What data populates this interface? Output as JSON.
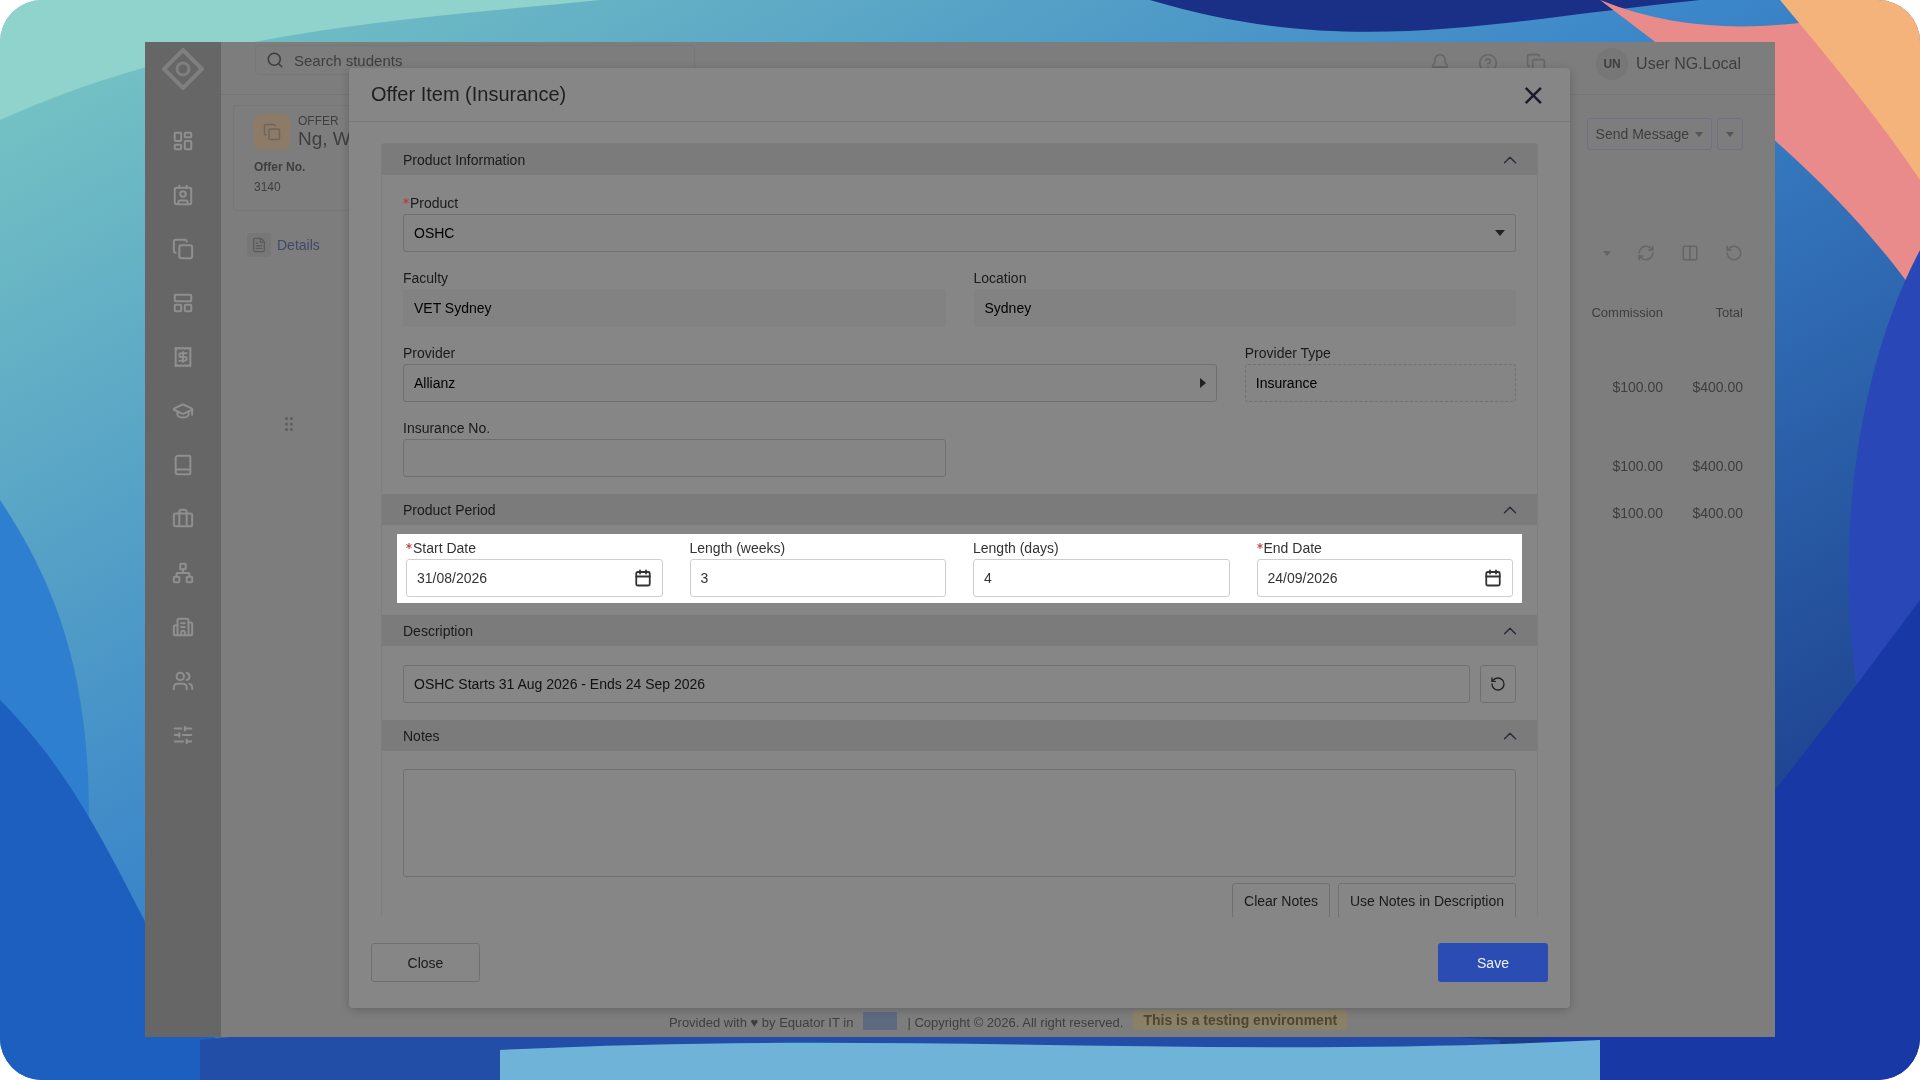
{
  "app": {
    "search": {
      "placeholder": "Search students"
    },
    "user": {
      "initials": "UN",
      "name": "User NG.Local"
    },
    "offer": {
      "label": "OFFER",
      "name": "Ng, W",
      "number_label": "Offer No.",
      "number": "3140",
      "tab": "Details"
    },
    "actions": {
      "send_message": "Send Message"
    },
    "table": {
      "columns": [
        "Commission",
        "Total"
      ],
      "rows": [
        [
          "$100.00",
          "$400.00"
        ],
        [
          "$100.00",
          "$400.00"
        ],
        [
          "$100.00",
          "$400.00"
        ]
      ]
    },
    "footer": {
      "credit": "Provided with ♥ by Equator IT in",
      "copyright": "| Copyright © 2026. All right reserved.",
      "environment": "This is a testing environment"
    }
  },
  "dialog": {
    "title": "Offer Item (Insurance)",
    "close": "×",
    "sections": [
      {
        "kind": "info",
        "title": "Product Information",
        "expanded": true,
        "highlighted": false,
        "rows": [
          [
            {
              "kind": "select",
              "label": "Product",
              "required": true,
              "value": "OSHC"
            }
          ],
          [
            {
              "kind": "readonly",
              "label": "Faculty",
              "required": false,
              "value": "VET Sydney"
            },
            {
              "kind": "readonly",
              "label": "Location",
              "required": false,
              "value": "Sydney"
            }
          ],
          [
            {
              "kind": "cascade",
              "label": "Provider",
              "required": false,
              "value": "Allianz"
            },
            {
              "kind": "static",
              "label": "Provider Type",
              "required": false,
              "value": "Insurance"
            }
          ],
          [
            {
              "kind": "input",
              "label": "Insurance No.",
              "required": false
            }
          ]
        ]
      },
      {
        "kind": "period",
        "title": "Product Period",
        "expanded": true,
        "highlighted": true,
        "rows": [
          [
            {
              "kind": "date",
              "label": "Start Date",
              "required": true,
              "value": "31/08/2026"
            },
            {
              "kind": "input",
              "label": "Length (weeks)",
              "required": false,
              "value": "3"
            },
            {
              "kind": "input",
              "label": "Length (days)",
              "required": false,
              "value": "4"
            },
            {
              "kind": "date",
              "label": "End Date",
              "required": true,
              "value": "24/09/2026"
            }
          ]
        ]
      },
      {
        "kind": "description",
        "title": "Description",
        "expanded": true,
        "highlighted": false,
        "value": "OSHC Starts 31 Aug 2026 - Ends 24 Sep 2026"
      },
      {
        "kind": "notes",
        "title": "Notes",
        "expanded": true,
        "highlighted": false,
        "buttons": [
          "Clear Notes",
          "Use Notes in Description"
        ]
      }
    ],
    "buttons": {
      "close": "Close",
      "save": "Save"
    }
  }
}
